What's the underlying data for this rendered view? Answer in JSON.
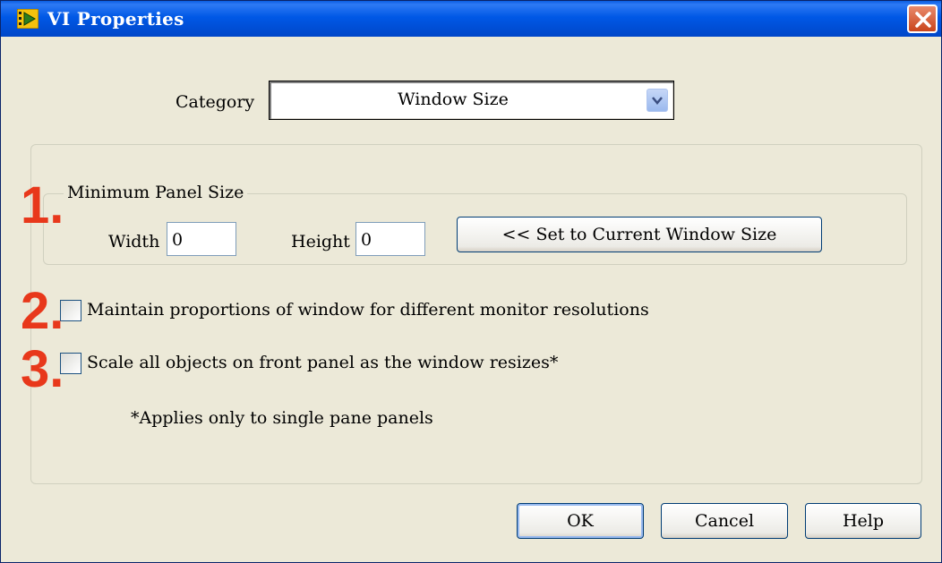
{
  "window": {
    "title": "VI Properties",
    "close_icon": "close-icon"
  },
  "category": {
    "label": "Category",
    "value": "Window Size"
  },
  "min_panel": {
    "legend": "Minimum Panel Size",
    "width_label": "Width",
    "width_value": "0",
    "height_label": "Height",
    "height_value": "0",
    "set_button": "<< Set to Current Window Size"
  },
  "options": {
    "maintain_label": "Maintain proportions of window for different monitor resolutions",
    "maintain_checked": false,
    "scale_label": "Scale all objects on front panel as the window resizes*",
    "scale_checked": false,
    "note": "*Applies only to single pane panels"
  },
  "annotations": {
    "one": "1.",
    "two": "2.",
    "three": "3.",
    "color": "#e8381b"
  },
  "buttons": {
    "ok": "OK",
    "cancel": "Cancel",
    "help": "Help"
  }
}
